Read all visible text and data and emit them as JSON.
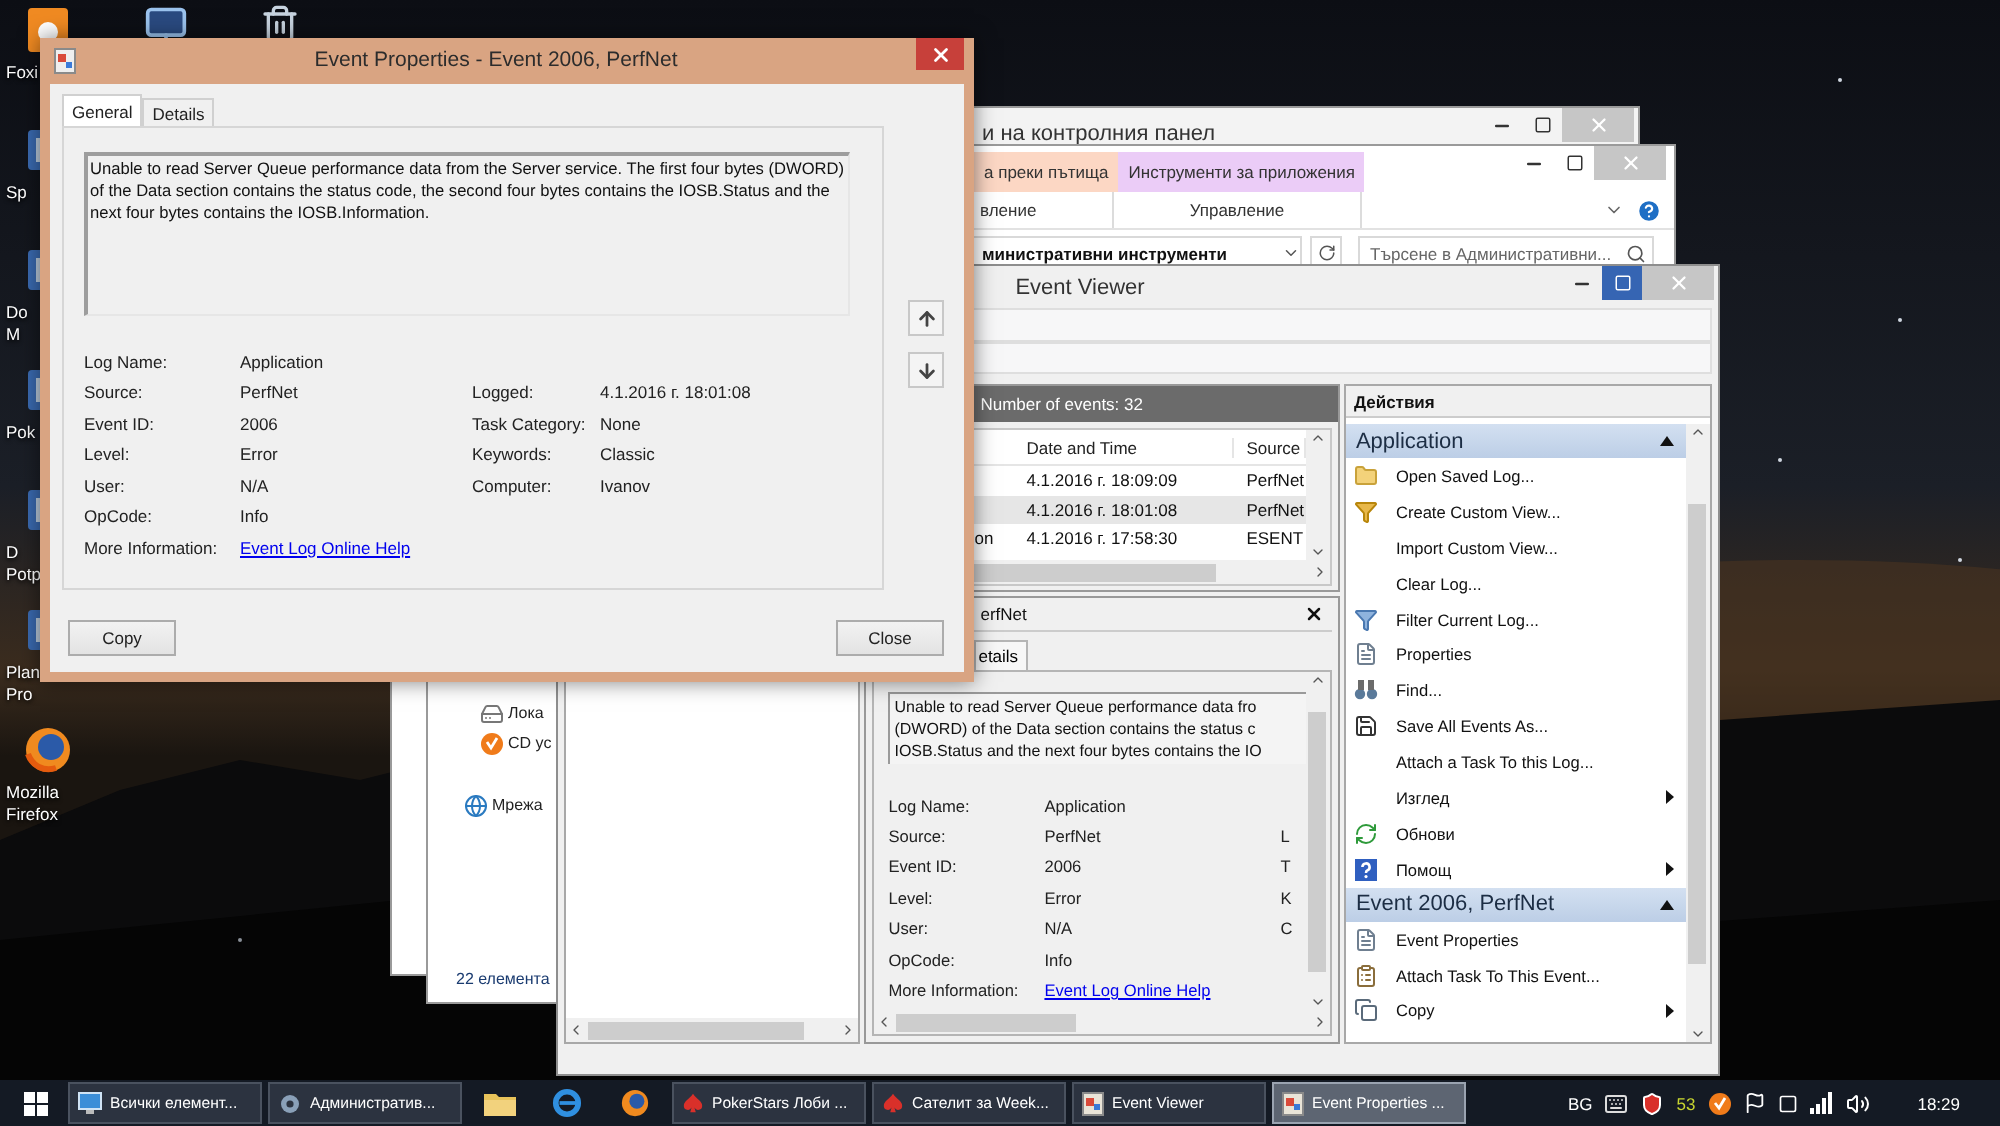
{
  "desktop": {
    "top_icons": [
      {
        "kind": "monitor"
      },
      {
        "kind": "recycle-bin"
      }
    ],
    "icons": [
      {
        "kind": "document",
        "lines": [
          "Foxi"
        ]
      },
      {
        "kind": "app",
        "lines": [
          "Sp"
        ]
      },
      {
        "kind": "app",
        "lines": [
          "Do",
          "M"
        ]
      },
      {
        "kind": "app",
        "lines": [
          "Pok"
        ]
      },
      {
        "kind": "app",
        "lines": [
          "D",
          "Potp"
        ]
      },
      {
        "kind": "app",
        "lines": [
          "Plan",
          "Pro"
        ]
      },
      {
        "kind": "firefox",
        "lines": [
          "Mozilla",
          "Firefox"
        ]
      }
    ]
  },
  "control_panel_window": {
    "title": "и на контролния панел"
  },
  "tools_window": {
    "ribbon_tabs": [
      {
        "label": "а преки пътища",
        "color": "#fcd7c4"
      },
      {
        "label": "Инструменти за приложения",
        "color": "#ebccf7"
      }
    ],
    "ribbon_groups": [
      "вление",
      "Управление"
    ],
    "address": "министративни инструменти",
    "search": {
      "placeholder": "Търсене в Административни..."
    },
    "nav_items": [
      {
        "children": [
          {
            "label": "Лока",
            "kind": "drive"
          },
          {
            "label": "CD ус",
            "kind": "disc"
          }
        ]
      },
      {
        "label": "Мрежа",
        "kind": "network"
      }
    ],
    "status": "22 елемента"
  },
  "event_viewer": {
    "title": "Event Viewer",
    "list_header": "Number of events: 32",
    "columns": [
      "Date and Time",
      "Source"
    ],
    "rows": [
      {
        "date": "4.1.2016 г. 18:09:09",
        "source": "PerfNet",
        "selected": false
      },
      {
        "date": "4.1.2016 г. 18:01:08",
        "source": "PerfNet",
        "selected": true
      },
      {
        "column_1": "on",
        "date": "4.1.2016 г. 17:58:30",
        "source": "ESENT",
        "selected": false
      }
    ],
    "preview": {
      "title": "erfNet",
      "tab": "etails",
      "message_lines": [
        "Unable to read Server Queue performance data fro",
        "(DWORD) of the Data section contains the status c",
        "IOSB.Status and the next four bytes contains the IO"
      ],
      "fields": [
        {
          "label": "Log Name:",
          "value": "Application"
        },
        {
          "label": "Source:",
          "value": "PerfNet",
          "column_3": "L"
        },
        {
          "label": "Event ID:",
          "value": "2006",
          "column_3": "T"
        },
        {
          "label": "Level:",
          "value": "Error",
          "column_3": "K"
        },
        {
          "label": "User:",
          "value": "N/A",
          "column_3": "C"
        },
        {
          "label": "OpCode:",
          "value": "Info"
        }
      ],
      "more_info": {
        "label": "More Information:",
        "link": "Event Log Online Help"
      }
    },
    "actions": {
      "header": "Действия",
      "sections": [
        {
          "title": "Application",
          "expanded": true,
          "items": [
            {
              "label": "Open Saved Log...",
              "kind": "folder",
              "submenu": false
            },
            {
              "label": "Create Custom View...",
              "kind": "funnel-gold",
              "submenu": false
            },
            {
              "label": "Import Custom View...",
              "kind": "plain",
              "submenu": false
            },
            {
              "label": "Clear Log...",
              "kind": "plain",
              "submenu": false
            },
            {
              "label": "Filter Current Log...",
              "kind": "funnel",
              "submenu": false
            },
            {
              "label": "Properties",
              "kind": "properties",
              "submenu": false
            },
            {
              "label": "Find...",
              "kind": "find",
              "submenu": false
            },
            {
              "label": "Save All Events As...",
              "kind": "save",
              "submenu": false
            },
            {
              "label": "Attach a Task To this Log...",
              "kind": "plain",
              "submenu": false
            },
            {
              "label": "Изглед",
              "kind": "plain",
              "submenu": true
            },
            {
              "label": "Обнови",
              "kind": "refresh",
              "submenu": false
            },
            {
              "label": "Помощ",
              "kind": "help",
              "submenu": true
            }
          ]
        },
        {
          "title": "Event 2006, PerfNet",
          "expanded": true,
          "items": [
            {
              "label": "Event Properties",
              "kind": "properties",
              "submenu": false
            },
            {
              "label": "Attach Task To This Event...",
              "kind": "task",
              "submenu": false
            },
            {
              "label": "Copy",
              "kind": "copy",
              "submenu": true
            }
          ]
        }
      ]
    }
  },
  "event_properties": {
    "title": "Event Properties - Event 2006, PerfNet",
    "tabs": [
      {
        "label": "General",
        "selected": true
      },
      {
        "label": "Details",
        "selected": false
      }
    ],
    "message": "Unable to read Server Queue performance data from the Server service. The first four bytes (DWORD) of the Data section contains the status code, the second four bytes contains the IOSB.Status and the next four bytes contains the IOSB.Information.",
    "fields_left": [
      {
        "label": "Log Name:",
        "value": "Application"
      },
      {
        "label": "Source:",
        "value": "PerfNet"
      },
      {
        "label": "Event ID:",
        "value": "2006"
      },
      {
        "label": "Level:",
        "value": "Error"
      },
      {
        "label": "User:",
        "value": "N/A"
      },
      {
        "label": "OpCode:",
        "value": "Info"
      }
    ],
    "fields_right": [
      {
        "label": "Logged:",
        "value": "4.1.2016 г. 18:01:08"
      },
      {
        "label": "Task Category:",
        "value": "None"
      },
      {
        "label": "Keywords:",
        "value": "Classic"
      },
      {
        "label": "Computer:",
        "value": "Ivanov"
      }
    ],
    "more_info": {
      "label": "More Information:",
      "link": "Event Log Online Help"
    },
    "buttons": [
      "Copy",
      "Close"
    ]
  },
  "taskbar": {
    "items": [
      {
        "kind": "control-panel",
        "label": "Всички елемент...",
        "selected": false
      },
      {
        "kind": "tools",
        "label": "Административ...",
        "selected": false
      },
      {
        "kind": "explorer"
      },
      {
        "kind": "ie"
      },
      {
        "kind": "firefox"
      },
      {
        "kind": "poker",
        "label": "PokerStars Лоби ...",
        "selected": false
      },
      {
        "kind": "poker",
        "label": "Сателит за Week...",
        "selected": false
      },
      {
        "kind": "event",
        "label": "Event Viewer",
        "selected": false
      },
      {
        "kind": "event",
        "label": "Event Properties ...",
        "selected": true
      }
    ],
    "tray": {
      "language": "BG",
      "counter": "53",
      "clock": "18:29"
    }
  }
}
